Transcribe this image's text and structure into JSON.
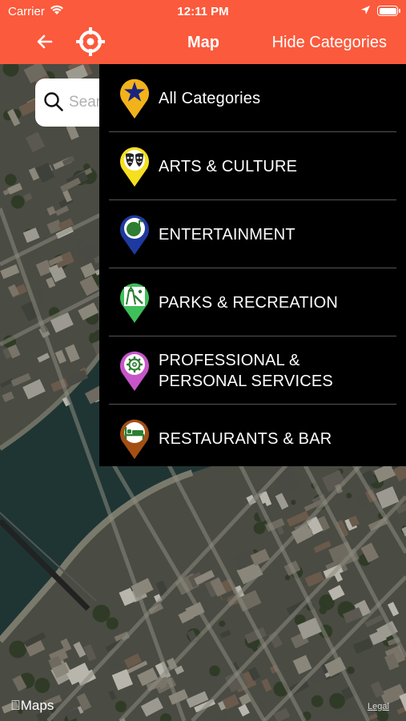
{
  "status_bar": {
    "carrier": "Carrier",
    "time": "12:11 PM"
  },
  "nav": {
    "title": "Map",
    "hide_categories_label": "Hide Categories",
    "back_icon": "arrow-left-icon",
    "locate_icon": "crosshair-icon",
    "bar_color": "#fb5a3c"
  },
  "search": {
    "placeholder": "Search"
  },
  "categories": [
    {
      "label": "All Categories",
      "icon": "star-icon",
      "pin_color": "#f2b21b"
    },
    {
      "label": "ARTS & CULTURE",
      "icon": "theater-masks-icon",
      "pin_color": "#f5df1f"
    },
    {
      "label": "ENTERTAINMENT",
      "icon": "music-note-icon",
      "pin_color": "#1e3aa0"
    },
    {
      "label": "PARKS & RECREATION",
      "icon": "playground-icon",
      "pin_color": "#3fbf5a"
    },
    {
      "label": "PROFESSIONAL & PERSONAL SERVICES",
      "label_lines": [
        "PROFESSIONAL &",
        "PERSONAL SERVICES"
      ],
      "icon": "gear-icon",
      "pin_color": "#c755c9"
    },
    {
      "label": "RESTAURANTS & BAR",
      "icon": "bed-icon",
      "pin_color": "#a34f14"
    }
  ],
  "map": {
    "attribution": "Maps",
    "legal": "Legal"
  }
}
